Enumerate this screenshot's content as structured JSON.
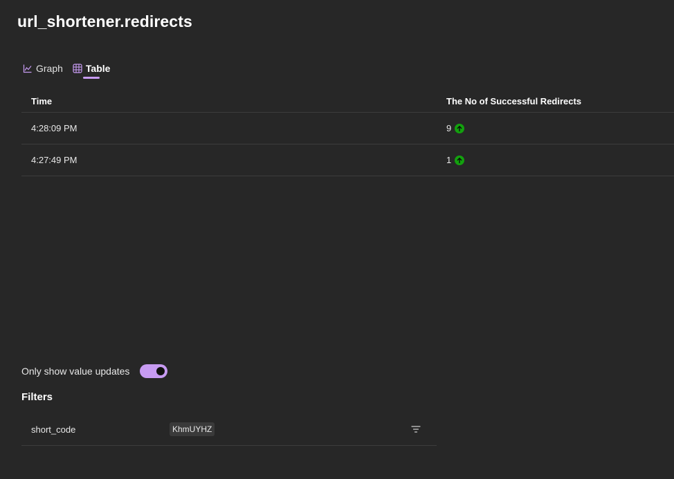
{
  "page": {
    "title": "url_shortener.redirects"
  },
  "tabs": [
    {
      "label": "Graph",
      "icon": "chart-icon",
      "active": false
    },
    {
      "label": "Table",
      "icon": "table-icon",
      "active": true
    }
  ],
  "table": {
    "columns": [
      "Time",
      "The No of Successful Redirects"
    ],
    "rows": [
      {
        "time": "4:28:09 PM",
        "value": "9",
        "trend": "up-arrow-icon"
      },
      {
        "time": "4:27:49 PM",
        "value": "1",
        "trend": "up-arrow-icon"
      }
    ]
  },
  "options": {
    "only_updates_label": "Only show value updates",
    "only_updates_enabled": true
  },
  "filters": {
    "title": "Filters",
    "items": [
      {
        "name": "short_code",
        "value": "KhmUYHZ",
        "icon": "filter-icon"
      }
    ]
  },
  "colors": {
    "background": "#272727",
    "accent": "#c79bf2",
    "trend_up": "#13a10e",
    "divider": "#3d3d3d"
  }
}
